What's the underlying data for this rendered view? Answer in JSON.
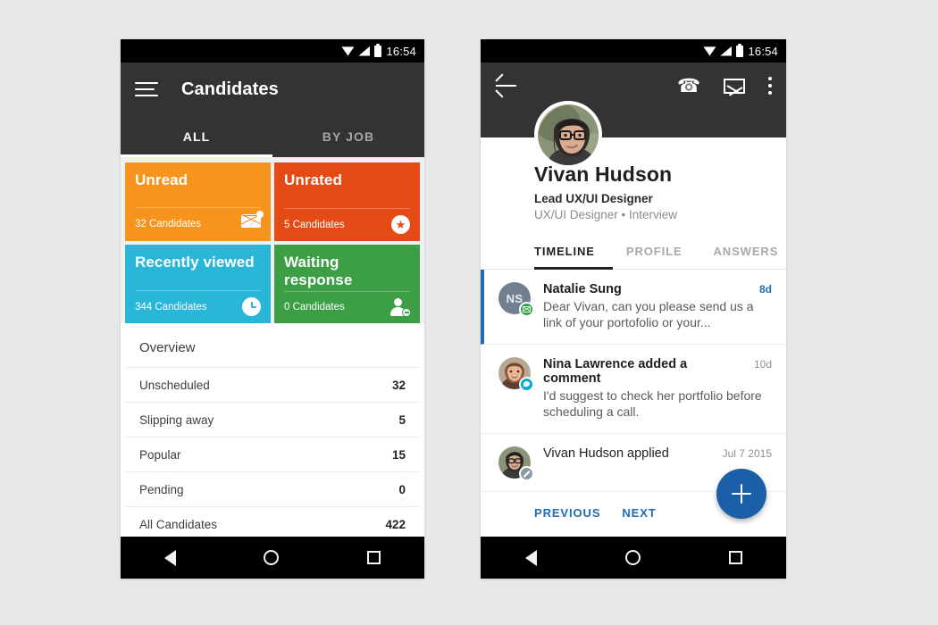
{
  "colors": {
    "page_bg": "#e8e8e8",
    "appbar": "#333333",
    "tile_unread": "#F7941D",
    "tile_unrated": "#E44A16",
    "tile_recent": "#29B6D8",
    "tile_waiting": "#3C9F45",
    "accent_blue": "#1f6cb5",
    "fab_blue": "#1A5FA8",
    "badge_mail_green": "#28A745",
    "badge_chat_cyan": "#00ACD6"
  },
  "status_bar": {
    "time": "16:54",
    "icons": [
      "wifi-icon",
      "signal-icon",
      "battery-icon"
    ]
  },
  "left_phone": {
    "appbar": {
      "menu_icon": "hamburger-menu-icon",
      "title": "Candidates"
    },
    "tabs": [
      {
        "label": "ALL",
        "active": true
      },
      {
        "label": "BY JOB",
        "active": false
      }
    ],
    "tiles": [
      {
        "title": "Unread",
        "count": "32 Candidates",
        "color": "#F7941D",
        "icon": "envelope-icon"
      },
      {
        "title": "Unrated",
        "count": "5 Candidates",
        "color": "#E44A16",
        "icon": "star-circle-icon"
      },
      {
        "title": "Recently viewed",
        "count": "344 Candidates",
        "color": "#29B6D8",
        "icon": "clock-icon"
      },
      {
        "title": "Waiting response",
        "count": "0 Candidates",
        "color": "#3C9F45",
        "icon": "person-remove-icon"
      }
    ],
    "overview": {
      "header": "Overview",
      "rows": [
        {
          "label": "Unscheduled",
          "value": "32"
        },
        {
          "label": "Slipping away",
          "value": "5"
        },
        {
          "label": "Popular",
          "value": "15"
        },
        {
          "label": "Pending",
          "value": "0"
        },
        {
          "label": "All Candidates",
          "value": "422"
        }
      ]
    }
  },
  "right_phone": {
    "appbar": {
      "back_icon": "back-arrow-icon",
      "actions": [
        "phone-icon",
        "mail-icon",
        "overflow-menu-icon"
      ]
    },
    "profile": {
      "avatar": "candidate-avatar-photo",
      "name": "Vivan Hudson",
      "role": "Lead UX/UI Designer",
      "meta": "UX/UI Designer  •  Interview"
    },
    "tabs": [
      {
        "label": "TIMELINE",
        "active": true
      },
      {
        "label": "PROFILE",
        "active": false
      },
      {
        "label": "ANSWERS",
        "active": false
      }
    ],
    "timeline": [
      {
        "avatar_type": "initials",
        "initials": "NS",
        "badge": "mail-badge-icon",
        "title": "Natalie Sung",
        "title_bold": true,
        "time": "8d",
        "time_highlight": true,
        "text": "Dear Vivan, can you please send us a link of your portofolio or your...",
        "accent": true
      },
      {
        "avatar_type": "photo",
        "initials": "",
        "badge": "comment-badge-icon",
        "title": "Nina Lawrence added a comment",
        "title_bold": true,
        "time": "10d",
        "time_highlight": false,
        "text": "I'd suggest to check her portfolio before scheduling a call.",
        "accent": false
      },
      {
        "avatar_type": "photo",
        "initials": "",
        "badge": "edit-badge-icon",
        "title": "Vivan Hudson applied",
        "title_bold": false,
        "time": "Jul 7 2015",
        "time_highlight": false,
        "text": "",
        "accent": false
      }
    ],
    "pager": [
      {
        "label": "PREVIOUS"
      },
      {
        "label": "NEXT"
      }
    ],
    "fab": {
      "icon": "plus-icon"
    }
  },
  "nav_bar": {
    "back": "nav-back-icon",
    "home": "nav-home-icon",
    "recents": "nav-recents-icon"
  }
}
